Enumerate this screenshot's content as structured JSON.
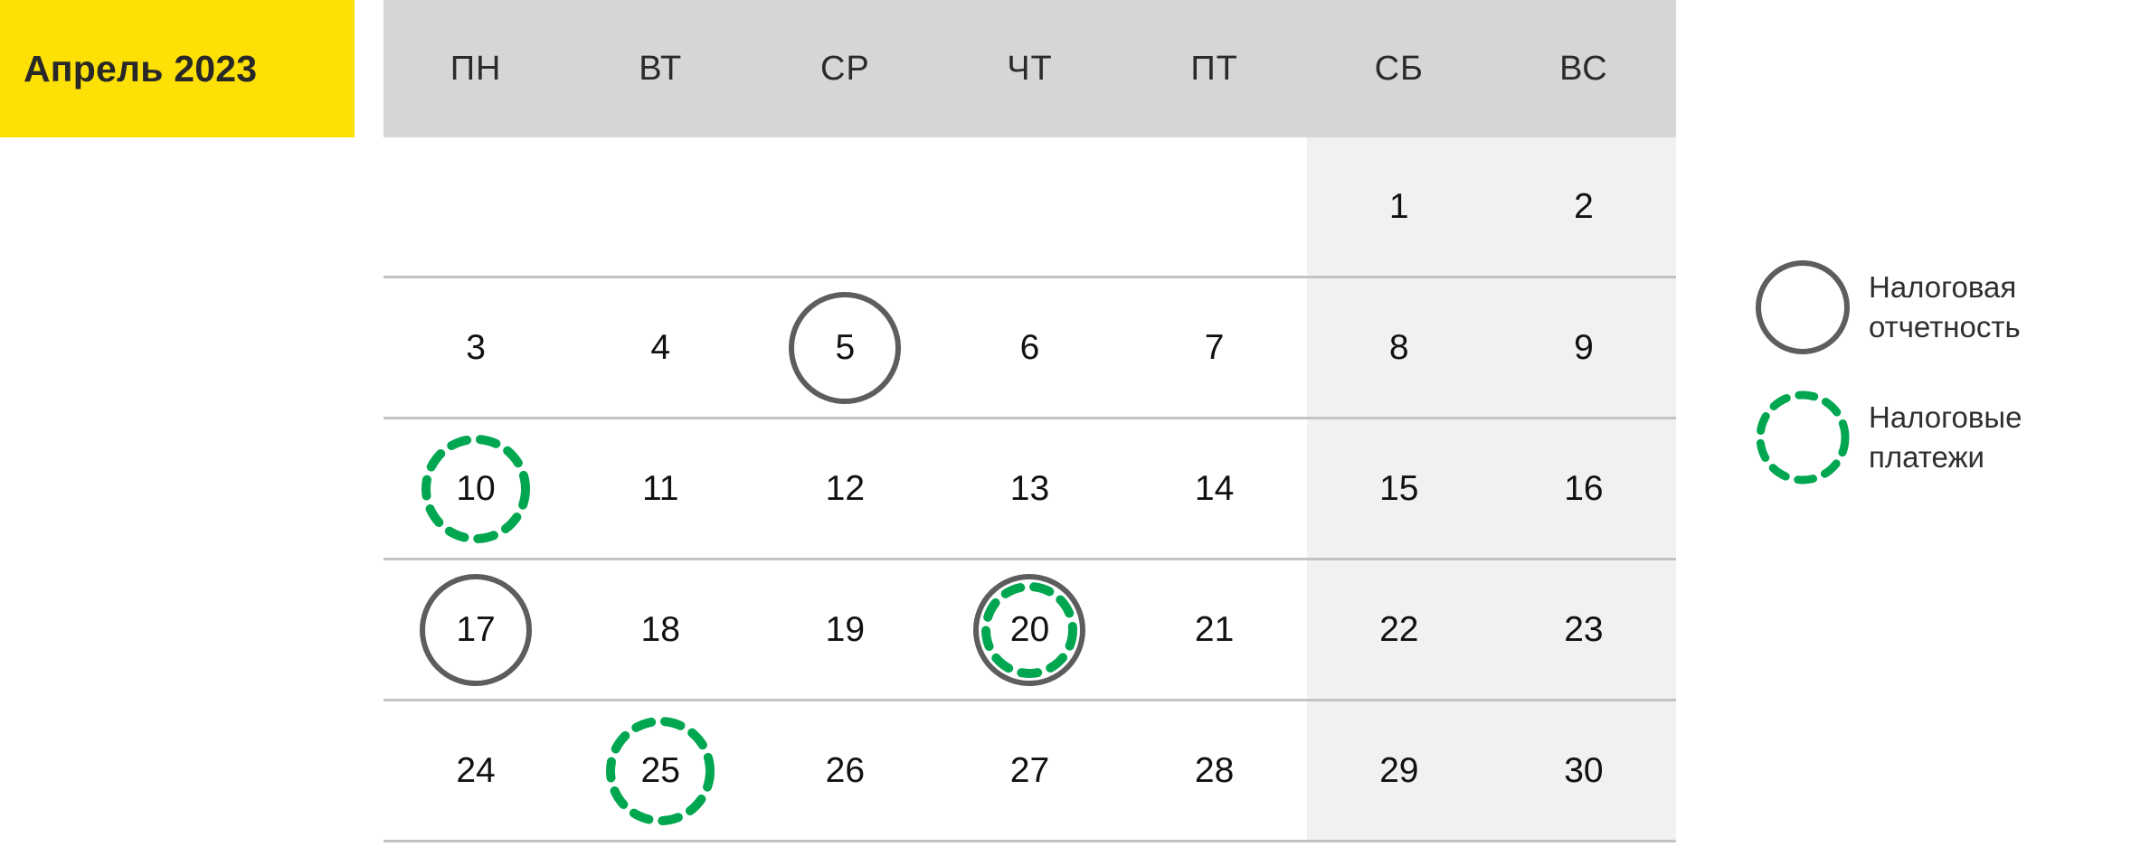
{
  "calendar": {
    "month_label": "Апрель 2023",
    "weekday_headers": [
      "ПН",
      "ВТ",
      "СР",
      "ЧТ",
      "ПТ",
      "СБ",
      "ВС"
    ],
    "weekend_columns": [
      5,
      6
    ],
    "weeks": [
      [
        {
          "day": ""
        },
        {
          "day": ""
        },
        {
          "day": ""
        },
        {
          "day": ""
        },
        {
          "day": ""
        },
        {
          "day": "1"
        },
        {
          "day": "2"
        }
      ],
      [
        {
          "day": "3"
        },
        {
          "day": "4"
        },
        {
          "day": "5",
          "marker": "report"
        },
        {
          "day": "6"
        },
        {
          "day": "7"
        },
        {
          "day": "8"
        },
        {
          "day": "9"
        }
      ],
      [
        {
          "day": "10",
          "marker": "payment"
        },
        {
          "day": "11"
        },
        {
          "day": "12"
        },
        {
          "day": "13"
        },
        {
          "day": "14"
        },
        {
          "day": "15"
        },
        {
          "day": "16"
        }
      ],
      [
        {
          "day": "17",
          "marker": "report"
        },
        {
          "day": "18"
        },
        {
          "day": "19"
        },
        {
          "day": "20",
          "marker": "report+payment"
        },
        {
          "day": "21"
        },
        {
          "day": "22"
        },
        {
          "day": "23"
        }
      ],
      [
        {
          "day": "24"
        },
        {
          "day": "25",
          "marker": "payment"
        },
        {
          "day": "26"
        },
        {
          "day": "27"
        },
        {
          "day": "28"
        },
        {
          "day": "29"
        },
        {
          "day": "30"
        }
      ]
    ]
  },
  "legend": {
    "items": [
      {
        "icon": "solid-circle-icon",
        "label": "Налоговая\nотчетность",
        "color": "#5d5d5d"
      },
      {
        "icon": "dashed-circle-icon",
        "label": "Налоговые\nплатежи",
        "color": "#00a650"
      }
    ]
  },
  "colors": {
    "title_background": "#fde006",
    "title_text": "#282828",
    "header_background": "#d6d6d6",
    "weekend_background": "#f1f1f1",
    "grid_line": "#c3c3c3",
    "report_marker": "#5d5d5d",
    "payment_marker": "#00a650"
  }
}
